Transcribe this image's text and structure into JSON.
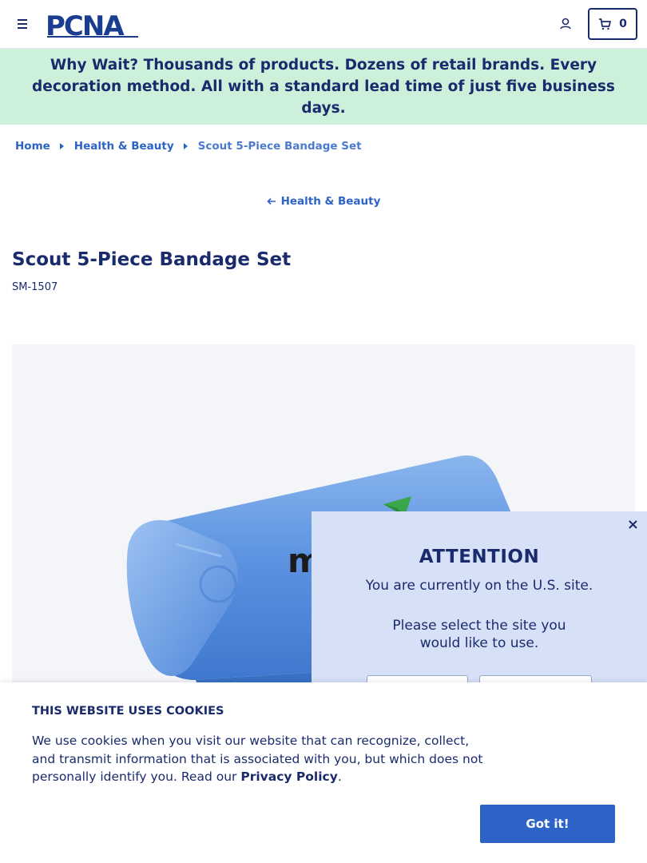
{
  "header": {
    "logo_text": "PCNA",
    "cart_count": "0",
    "icons": {
      "menu": "hamburger-menu-icon",
      "account": "user-icon",
      "cart": "cart-icon"
    }
  },
  "promo": {
    "text": "Why Wait? Thousands of products. Dozens of retail brands. Every decoration method. All with a standard lead time of just five business days."
  },
  "breadcrumb": {
    "items": [
      "Home",
      "Health & Beauty"
    ],
    "current": "Scout 5-Piece Bandage Set"
  },
  "back_link": {
    "label": "Health & Beauty"
  },
  "product": {
    "title": "Scout 5-Piece Bandage Set",
    "sku": "SM-1507",
    "imprint_text": "m"
  },
  "modal": {
    "close_label": "×",
    "title": "ATTENTION",
    "line1": "You are currently on the U.S. site.",
    "line2": "Please select the site you would like to use."
  },
  "cookie": {
    "title": "THIS WEBSITE USES COOKIES",
    "text_before": "We use cookies when you visit our website that can recognize, collect, and transmit information that is associated with you, but which does not personally identify you. Read our ",
    "link_text": "Privacy Policy",
    "text_after": ".",
    "button_label": "Got it!"
  },
  "colors": {
    "navy": "#1a2b6d",
    "link_blue": "#2d63c6",
    "promo_bg": "#cdf0da",
    "modal_bg": "#d6e0f6",
    "product_blue": "#5a8fdc"
  }
}
